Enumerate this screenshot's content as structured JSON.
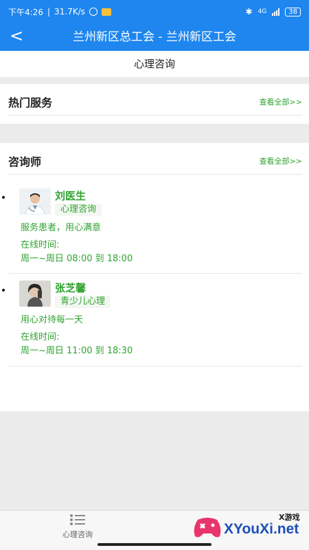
{
  "status_bar": {
    "time": "下午4:26",
    "speed": "31.7K/s",
    "network": "4G",
    "battery": "38"
  },
  "nav": {
    "back_label": "<",
    "title": "兰州新区总工会 - 兰州新区工会"
  },
  "tab": {
    "label": "心理咨询"
  },
  "hot_services": {
    "title": "热门服务",
    "more": "查看全部>>"
  },
  "counselors": {
    "title": "咨询师",
    "more": "查看全部>>",
    "items": [
      {
        "name": "刘医生",
        "tag": "心理咨询",
        "motto": "服务患者，用心满意",
        "online_label": "在线时间:",
        "hours": "周一~周日 08:00 到 18:00"
      },
      {
        "name": "张芝馨",
        "tag": "青少儿心理",
        "motto": "用心对待每一天",
        "online_label": "在线时间:",
        "hours": "周一~周日 11:00 到 18:30"
      }
    ]
  },
  "bottom_nav": {
    "item_label": "心理咨询",
    "icon": "list-icon"
  },
  "watermark": {
    "top": "X游戏",
    "text": "XYouXi.net"
  },
  "colors": {
    "primary": "#1e86ee",
    "accent": "#2fa32f"
  }
}
